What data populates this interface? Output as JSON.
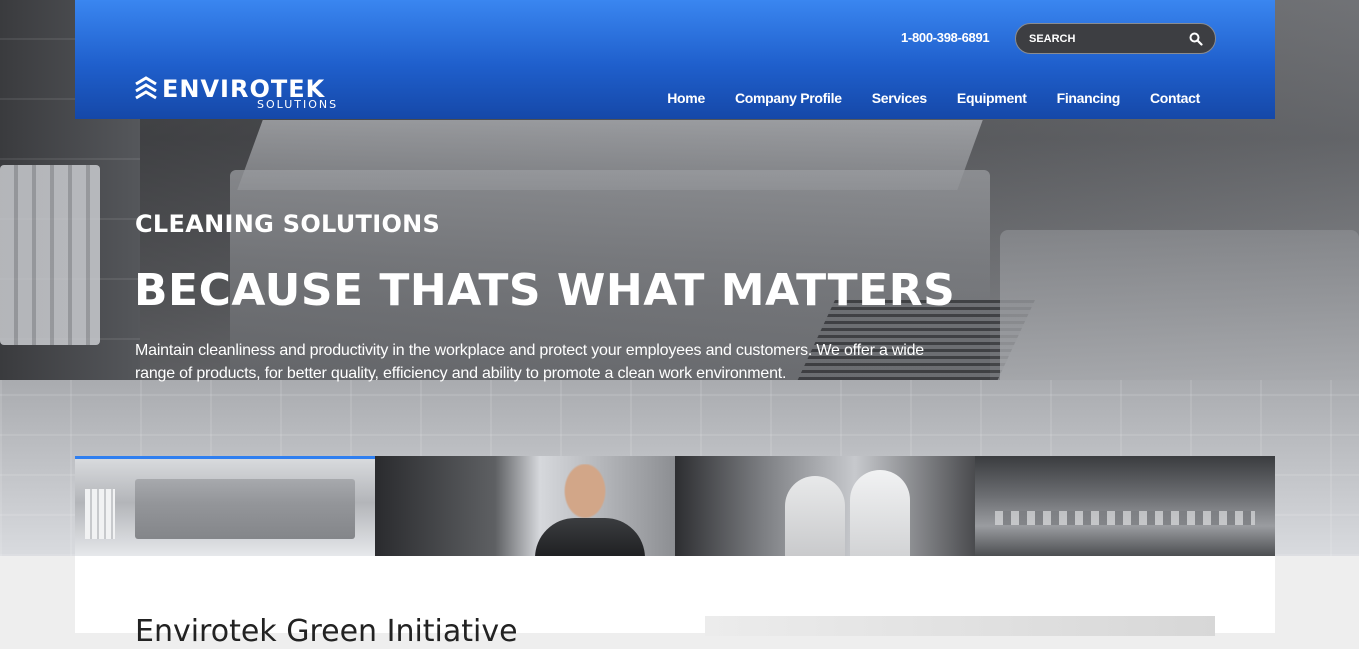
{
  "header": {
    "logo_text": "ENVIROTEK",
    "logo_sub": "SOLUTIONS",
    "phone": "1-800-398-6891",
    "search": {
      "placeholder": "SEARCH"
    },
    "nav": [
      "Home",
      "Company Profile",
      "Services",
      "Equipment",
      "Financing",
      "Contact"
    ]
  },
  "hero": {
    "eyebrow": "CLEANING SOLUTIONS",
    "title": "BECAUSE THATS WHAT MATTERS",
    "description": "Maintain cleanliness and productivity in the workplace and protect your employees and customers. We offer a wide range of products, for better quality, efficiency and ability to promote a clean work environment."
  },
  "thumbnails": {
    "active_index": 0,
    "count": 4
  },
  "content": {
    "heading": "Envirotek Green Initiative"
  },
  "colors": {
    "header_top": "#3a86f0",
    "header_bottom": "#1548a8",
    "accent": "#2f7ff0",
    "search_bg": "#3d3e42"
  },
  "icons": {
    "search": "search-icon",
    "logo_mark": "chevron-stack-icon"
  }
}
